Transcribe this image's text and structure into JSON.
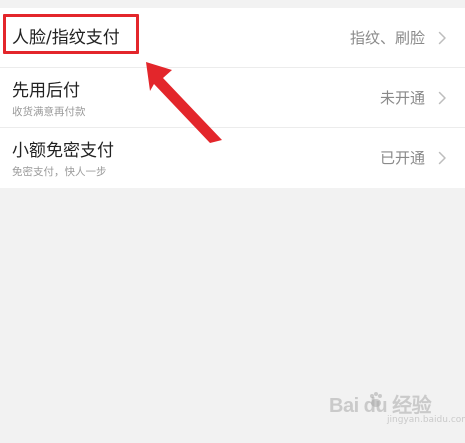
{
  "rows": [
    {
      "title": "人脸/指纹支付",
      "subtitle": "",
      "value": "指纹、刷脸"
    },
    {
      "title": "先用后付",
      "subtitle": "收货满意再付款",
      "value": "未开通"
    },
    {
      "title": "小额免密支付",
      "subtitle": "免密支付，快人一步",
      "value": "已开通"
    }
  ],
  "colors": {
    "highlight": "#e3262b",
    "background": "#f2f2f2",
    "title_text": "#222222",
    "value_text": "#8a8a8a"
  },
  "watermark": {
    "text": "Bai du 经验",
    "sub": "jingyan.baidu.com",
    "icon": "paw-icon"
  }
}
